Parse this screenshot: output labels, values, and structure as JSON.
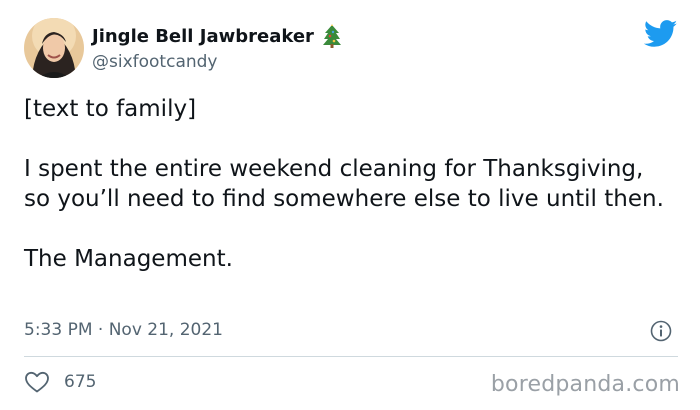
{
  "author": {
    "display_name": "Jingle Bell Jawbreaker",
    "name_emoji_icon": "christmas-tree-icon",
    "handle": "@sixfootcandy"
  },
  "platform_icon": "twitter-bird-icon",
  "tweet": {
    "lines": [
      "[text to family]",
      "I spent the entire weekend cleaning for Thanksgiving, so you’ll need to find somewhere else to live until then.",
      "The Management."
    ],
    "timestamp": "5:33 PM · Nov 21, 2021"
  },
  "actions": {
    "like_icon": "heart-icon",
    "like_count": "675",
    "info_icon": "info-icon"
  },
  "watermark": "boredpanda.com",
  "colors": {
    "text": "#0f1419",
    "muted": "#536471",
    "twitter_blue": "#1d9bf0",
    "divider": "#cfd9de"
  }
}
